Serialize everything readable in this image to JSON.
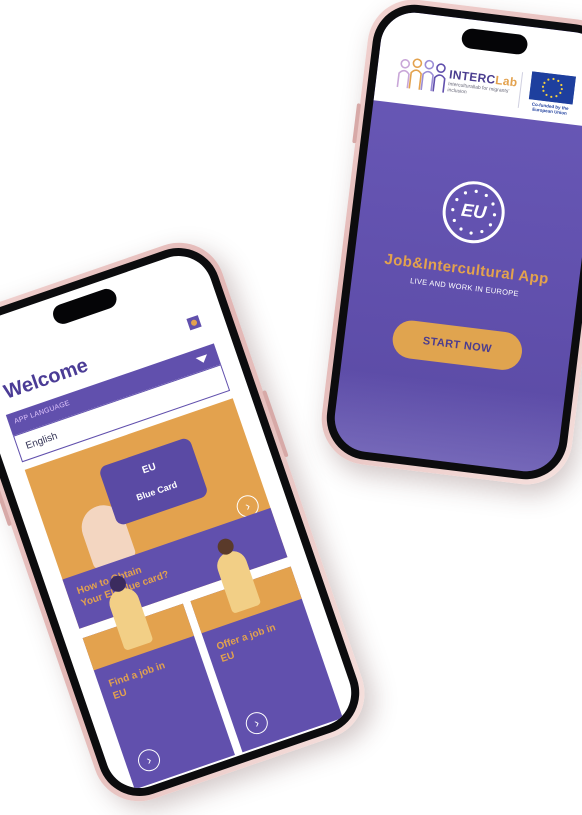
{
  "start_screen": {
    "logo_name_main": "INTERC",
    "logo_name_accent": "Lab",
    "logo_subtitle": "Interculturallab for migrants' inclusion",
    "cofunded_text": "Co-funded by the European Union",
    "badge_text": "EU",
    "app_title": "Job&Intercultural App",
    "app_subtitle": "LIVE AND WORK IN EUROPE",
    "start_button": "START NOW"
  },
  "home_screen": {
    "welcome_title": "Welcome",
    "language_label": "APP LANGUAGE",
    "language_value": "English",
    "bluecard_card": {
      "card_eu": "EU",
      "card_label": "Blue Card",
      "title_line1": "How to Obtain",
      "title_line2": "Your EU blue card?"
    },
    "find_job_card": {
      "title_line1": "Find a job in",
      "title_line2": "EU"
    },
    "offer_job_card": {
      "title_line1": "Offer a job in",
      "title_line2": "EU"
    }
  },
  "colors": {
    "primary_purple": "#6150ad",
    "accent_orange": "#e3a24e",
    "eu_blue": "#1e3f9e"
  },
  "icons": [
    "eu-stars-icon",
    "chevron-right-circle-icon",
    "dropdown-caret-icon"
  ]
}
